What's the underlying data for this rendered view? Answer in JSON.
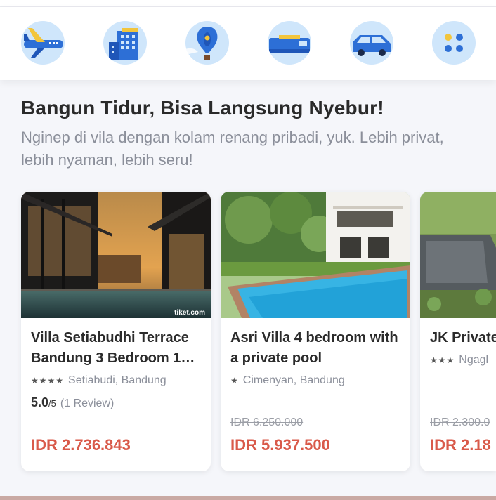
{
  "categories": [
    {
      "name": "flight",
      "icon": "airplane-icon"
    },
    {
      "name": "hotel",
      "icon": "hotel-building-icon"
    },
    {
      "name": "attraction",
      "icon": "hot-air-balloon-icon"
    },
    {
      "name": "train",
      "icon": "train-icon"
    },
    {
      "name": "car",
      "icon": "car-icon"
    },
    {
      "name": "more",
      "icon": "more-grid-icon"
    }
  ],
  "section": {
    "title": "Bangun Tidur, Bisa Langsung Nyebur!",
    "subtitle": "Nginep di vila dengan kolam renang pribadi, yuk. Lebih privat, lebih nyaman, lebih seru!"
  },
  "cards": [
    {
      "name": "Villa Setiabudhi Terrace Bandung 3 Bedroom 1…",
      "stars": "★★★★",
      "location": "Setiabudi, Bandung",
      "rating_value": "5.0",
      "rating_scale": "/5",
      "reviews": "(1 Review)",
      "original_price": "",
      "price": "IDR 2.736.843",
      "photo_watermark": "tiket.com"
    },
    {
      "name": "Asri Villa 4 bedroom with a private pool",
      "stars": "★",
      "location": "Cimenyan, Bandung",
      "original_price": "IDR 6.250.000",
      "price": "IDR 5.937.500"
    },
    {
      "name": "JK Private",
      "stars": "★★★",
      "location": "Ngagl",
      "original_price": "IDR 2.300.0",
      "price": "IDR 2.18"
    }
  ],
  "colors": {
    "price": "#d95a4a",
    "icon_circle": "#cfe6fb",
    "icon_blue": "#2d6fd6"
  }
}
